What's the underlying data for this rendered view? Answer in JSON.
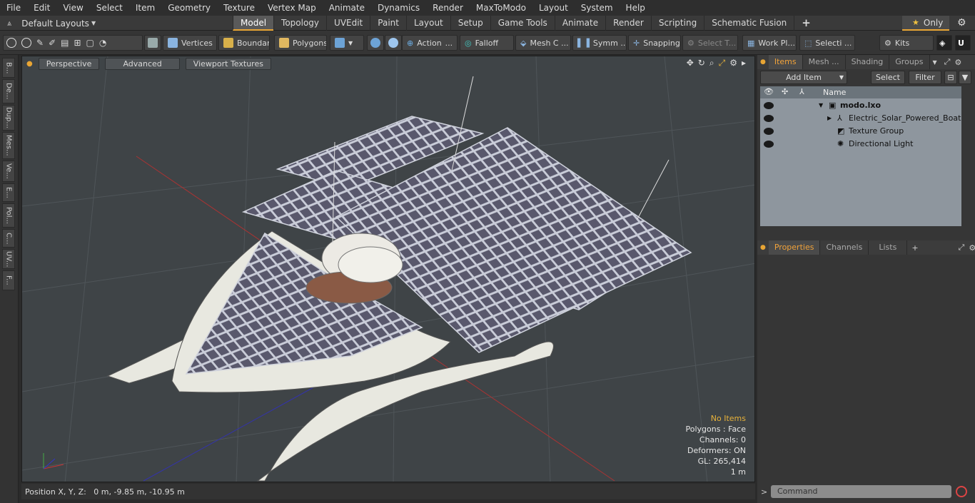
{
  "menu": [
    "File",
    "Edit",
    "View",
    "Select",
    "Item",
    "Geometry",
    "Texture",
    "Vertex Map",
    "Animate",
    "Dynamics",
    "Render",
    "MaxToModo",
    "Layout",
    "System",
    "Help"
  ],
  "layouts_label": "Default Layouts",
  "tabs": [
    "Model",
    "Topology",
    "UVEdit",
    "Paint",
    "Layout",
    "Setup",
    "Game Tools",
    "Animate",
    "Render",
    "Scripting",
    "Schematic Fusion"
  ],
  "only_label": "Only",
  "toolbar": {
    "vertices": "Vertices",
    "boundary": "Boundary",
    "polygons": "Polygons",
    "action": "Action",
    "falloff": "Falloff",
    "mesh": "Mesh C ...",
    "symm": "Symm ...",
    "snapping": "Snapping",
    "select_t": "Select T...",
    "workpl": "Work Pl...",
    "selecti": "Selecti ...",
    "kits": "Kits"
  },
  "left_tabs": [
    "B...",
    "De...",
    "Dup...",
    "Mes...",
    "Ve...",
    "E...",
    "Pol...",
    "C...",
    "UV...",
    "F..."
  ],
  "viewport": {
    "perspective": "Perspective",
    "advanced": "Advanced",
    "textures": "Viewport Textures"
  },
  "stats": {
    "no_items": "No Items",
    "polygons": "Polygons : Face",
    "channels": "Channels: 0",
    "deformers": "Deformers: ON",
    "gl": "GL: 265,414",
    "unit": "1 m"
  },
  "status": "Position X, Y, Z:   0 m, -9.85 m, -10.95 m",
  "panel": {
    "tabs": [
      "Items",
      "Mesh ...",
      "Shading",
      "Groups"
    ],
    "add_item": "Add Item",
    "select": "Select",
    "filter": "Filter",
    "name_col": "Name",
    "items": [
      "modo.lxo",
      "Electric_Solar_Powered_Boat ...",
      "Texture Group",
      "Directional Light"
    ],
    "prop_tabs": [
      "Properties",
      "Channels",
      "Lists"
    ]
  },
  "command_placeholder": "Command"
}
